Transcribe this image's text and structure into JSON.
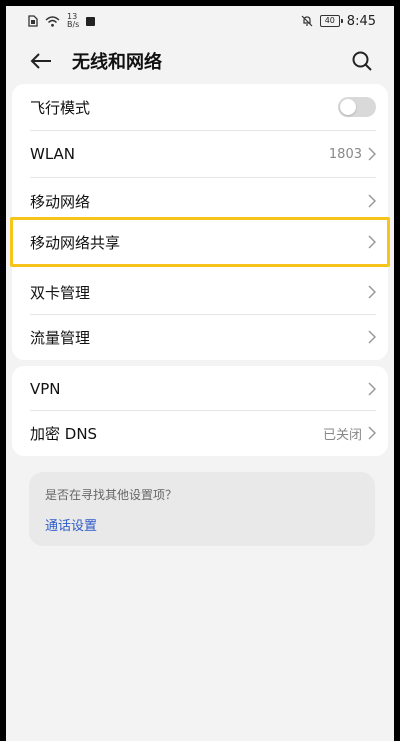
{
  "status_bar": {
    "speed_top": "13",
    "speed_bottom": "B/s",
    "battery": "40",
    "time": "8:45"
  },
  "header": {
    "title": "无线和网络"
  },
  "rows": [
    {
      "label": "飞行模式",
      "value": "",
      "type": "toggle",
      "toggle_on": false
    },
    {
      "label": "WLAN",
      "value": "1803",
      "type": "chevron"
    },
    {
      "label": "移动网络",
      "value": "",
      "type": "chevron"
    },
    {
      "label": "移动网络共享",
      "value": "",
      "type": "chevron",
      "highlighted": true
    },
    {
      "label": "双卡管理",
      "value": "",
      "type": "chevron"
    },
    {
      "label": "流量管理",
      "value": "",
      "type": "chevron"
    }
  ],
  "rows2": [
    {
      "label": "VPN",
      "value": "",
      "type": "chevron"
    },
    {
      "label": "加密 DNS",
      "value": "已关闭",
      "type": "chevron"
    }
  ],
  "suggest": {
    "question": "是否在寻找其他设置项？",
    "link": "通话设置"
  },
  "colors": {
    "highlight": "#f7c51a",
    "link": "#2f5cc9"
  },
  "icons": {
    "back": "arrow-left-icon",
    "search": "search-icon",
    "chevron": "chevron-right-icon"
  }
}
